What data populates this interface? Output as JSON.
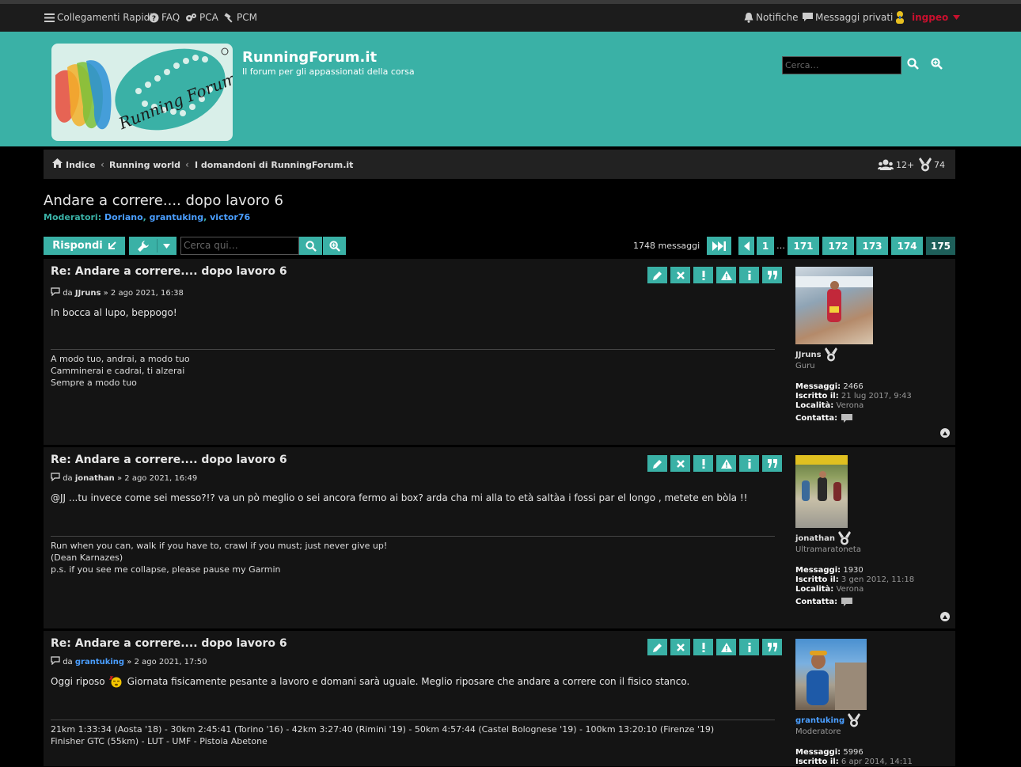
{
  "topbar": {
    "quicklinks": "Collegamenti Rapidi",
    "faq": "FAQ",
    "pca": "PCA",
    "pcm": "PCM",
    "notifications": "Notifiche",
    "pm": "Messaggi privati",
    "user": "ingpeo"
  },
  "header": {
    "title": "RunningForum.it",
    "description": "Il forum per gli appassionati della corsa",
    "search_placeholder": "Cerca…",
    "logo_text": "Running Forum"
  },
  "breadcrumbs": [
    "Indice",
    "Running world",
    "I domandoni di RunningForum.it"
  ],
  "stats": {
    "online": "12+",
    "medals": "74"
  },
  "topic": {
    "title": "Andare a correre.... dopo lavoro 6",
    "moderators_label": "Moderatori:",
    "moderators": [
      "Doriano",
      "grantuking",
      "victor76"
    ]
  },
  "toolbar": {
    "reply": "Rispondi",
    "search_placeholder": "Cerca qui…",
    "count": "1748 messaggi",
    "pages": [
      "1",
      "…",
      "171",
      "172",
      "173",
      "174",
      "175"
    ]
  },
  "colors": {
    "accent": "#3ab1a6",
    "link": "#4a9eff"
  },
  "posts": [
    {
      "title": "Re: Andare a correre.... dopo lavoro 6",
      "by": "da",
      "author": "JJruns",
      "date": "2 ago 2021, 16:38",
      "body": "In bocca al lupo, beppogo!",
      "signature": [
        "A modo tuo, andrai, a modo tuo",
        "Camminerai e cadrai, ti alzerai",
        "Sempre a modo tuo"
      ],
      "rank": "Guru",
      "messages_label": "Messaggi:",
      "messages": "2466",
      "joined_label": "Iscritto il:",
      "joined": "21 lug 2017, 9:43",
      "location_label": "Località:",
      "location": "Verona",
      "contact_label": "Contatta:"
    },
    {
      "title": "Re: Andare a correre.... dopo lavoro 6",
      "by": "da",
      "author": "jonathan",
      "date": "2 ago 2021, 16:49",
      "body": "@JJ ...tu invece come sei messo?!? va un pò meglio o sei ancora fermo ai box? arda cha mi alla to età saltàa i fossi par el longo , metete en bòla !!",
      "signature": [
        "Run when you can, walk if you have to, crawl if you must; just never give up!",
        "(Dean Karnazes)",
        "p.s. if you see me collapse, please pause my Garmin"
      ],
      "rank": "Ultramaratoneta",
      "messages_label": "Messaggi:",
      "messages": "1930",
      "joined_label": "Iscritto il:",
      "joined": "3 gen 2012, 11:18",
      "location_label": "Località:",
      "location": "Verona",
      "contact_label": "Contatta:"
    },
    {
      "title": "Re: Andare a correre.... dopo lavoro 6",
      "by": "da",
      "author": "grantuking",
      "date": "2 ago 2021, 17:50",
      "body_a": "Oggi riposo",
      "body_b": "Giornata fisicamente pesante a lavoro e domani sarà uguale. Meglio riposare che andare a correre con il fisico stanco.",
      "signature": [
        "21km 1:33:34 (Aosta '18) - 30km 2:45:41 (Torino '16) - 42km 3:27:40 (Rimini '19) - 50km 4:57:44 (Castel Bolognese '19) - 100km 13:20:10 (Firenze '19)",
        "Finisher GTC (55km) - LUT - UMF - Pistoia Abetone"
      ],
      "rank": "Moderatore",
      "messages_label": "Messaggi:",
      "messages": "5996",
      "joined_label": "Iscritto il:",
      "joined": "6 apr 2014, 14:11"
    }
  ]
}
